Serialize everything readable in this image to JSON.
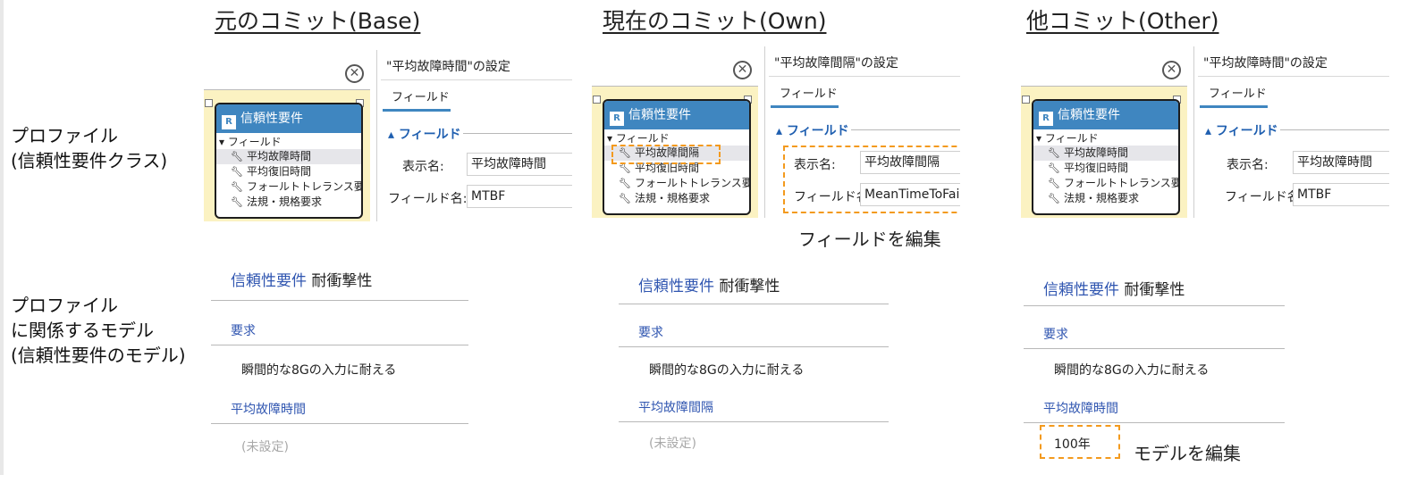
{
  "columns": [
    {
      "title": "元のコミット(Base)",
      "panel": {
        "class_name": "信頼性要件",
        "class_icon": "R",
        "fields_header": "フィールド",
        "fields": [
          "平均故障時間",
          "平均復旧時間",
          "フォールトトレランス要求",
          "法規・規格要求"
        ],
        "settings_title": "\"平均故障時間\"の設定",
        "tab": "フィールド",
        "section": "フィールド",
        "display_name_label": "表示名:",
        "display_name_value": "平均故障時間",
        "field_name_label": "フィールド名:",
        "field_name_value": "MTBF"
      },
      "model": {
        "class_label": "信頼性要件",
        "instance_name": "耐衝撃性",
        "req_section": "要求",
        "req_value": "瞬間的な8Gの入力に耐える",
        "field_section": "平均故障時間",
        "field_value": "(未設定)"
      }
    },
    {
      "title": "現在のコミット(Own)",
      "panel": {
        "class_name": "信頼性要件",
        "class_icon": "R",
        "fields_header": "フィールド",
        "fields": [
          "平均故障間隔",
          "平均復旧時間",
          "フォールトトレランス要求",
          "法規・規格要求"
        ],
        "settings_title": "\"平均故障間隔\"の設定",
        "tab": "フィールド",
        "section": "フィールド",
        "display_name_label": "表示名:",
        "display_name_value": "平均故障間隔",
        "field_name_label": "フィールド名:",
        "field_name_value": "MeanTimeToFailure"
      },
      "annotation": "フィールドを編集",
      "model": {
        "class_label": "信頼性要件",
        "instance_name": "耐衝撃性",
        "req_section": "要求",
        "req_value": "瞬間的な8Gの入力に耐える",
        "field_section": "平均故障間隔",
        "field_value": "(未設定)"
      }
    },
    {
      "title": "他コミット(Other)",
      "panel": {
        "class_name": "信頼性要件",
        "class_icon": "R",
        "fields_header": "フィールド",
        "fields": [
          "平均故障時間",
          "平均復旧時間",
          "フォールトトレランス要求",
          "法規・規格要求"
        ],
        "settings_title": "\"平均故障時間\"の設定",
        "tab": "フィールド",
        "section": "フィールド",
        "display_name_label": "表示名:",
        "display_name_value": "平均故障時間",
        "field_name_label": "フィールド名:",
        "field_name_value": "MTBF"
      },
      "model": {
        "class_label": "信頼性要件",
        "instance_name": "耐衝撃性",
        "req_section": "要求",
        "req_value": "瞬間的な8Gの入力に耐える",
        "field_section": "平均故障時間",
        "field_value": "100年"
      },
      "annotation": "モデルを編集"
    }
  ],
  "row_labels": {
    "profile": "プロファイル\n(信頼性要件クラス)",
    "model": "プロファイル\nに関係するモデル\n(信頼性要件のモデル)"
  },
  "icons": {
    "close": "close-circle-icon",
    "field": "wrench-icon",
    "collapse": "triangle-down-icon"
  },
  "colors": {
    "class_header": "#3f86c0",
    "highlight_dash": "#f39a1e",
    "link_blue": "#2f55b0",
    "selection_band": "#fbf2c2"
  }
}
